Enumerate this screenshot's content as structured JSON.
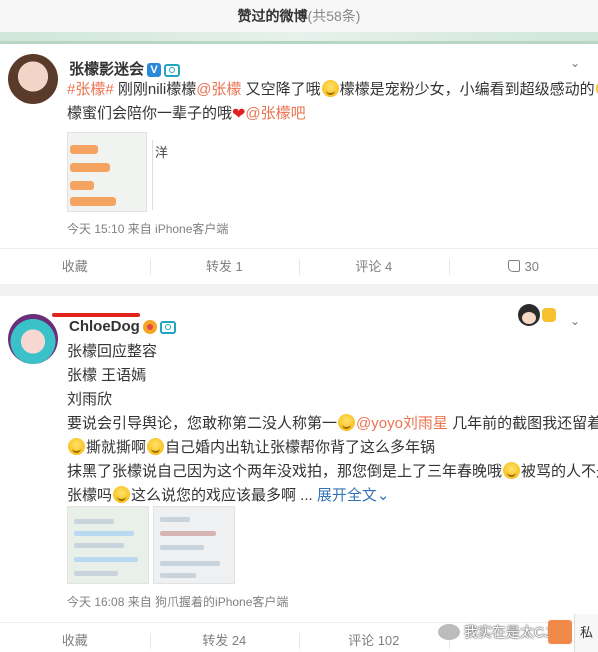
{
  "header": {
    "title": "赞过的微博",
    "count": "(共58条)"
  },
  "post1": {
    "username": "张檬影迷会",
    "verified_mark": "V",
    "line1_hashtag": "#张檬#",
    "line1_a": " 刚刚nili檬檬",
    "line1_mention": "@张檬",
    "line1_b": " 又空降了哦",
    "line1_c": "檬檬是宠粉少女，小编看到超级感动的",
    "line2_a": "檬蜜们会陪你一辈子的哦",
    "line2_mention": "@张檬吧",
    "thumb_extra": "洋",
    "meta": "今天 15:10 来自 iPhone客户端",
    "actions": {
      "fav": "收藏",
      "repost": "转发 1",
      "comment": "评论 4",
      "like": "30"
    }
  },
  "post2": {
    "username": "ChloeDog",
    "l1": "张檬回应整容",
    "l2": "张檬 王语嫣",
    "l3": "刘雨欣",
    "l4_a": "要说会引导舆论，您敢称第二没人称第一",
    "l4_mention": "@yoyo刘雨星",
    "l4_b": " 几年前的截图我还留着呢",
    "l5_a": "撕就撕啊",
    "l5_b": "自己婚内出轨让张檬帮你背了这么多年锅",
    "l6_a": "抹黑了张檬说自己因为这个两年没戏拍，那您倒是上了三年春晚哦",
    "l6_b": "被骂的人不是",
    "l7_a": "张檬吗",
    "l7_b": "这么说您的戏应该最多啊 ... ",
    "expand": "展开全文",
    "meta": "今天 16:08 来自 狗爪握着的iPhone客户端",
    "actions": {
      "fav": "收藏",
      "repost": "转发 24",
      "comment": "评论 102",
      "like": ""
    }
  },
  "watermark": {
    "text": "我实在是太CJ了",
    "side": "私"
  },
  "colors": {
    "link_orange": "#eb7350",
    "link_blue": "#3574b5",
    "underline_red": "#e3241c"
  }
}
